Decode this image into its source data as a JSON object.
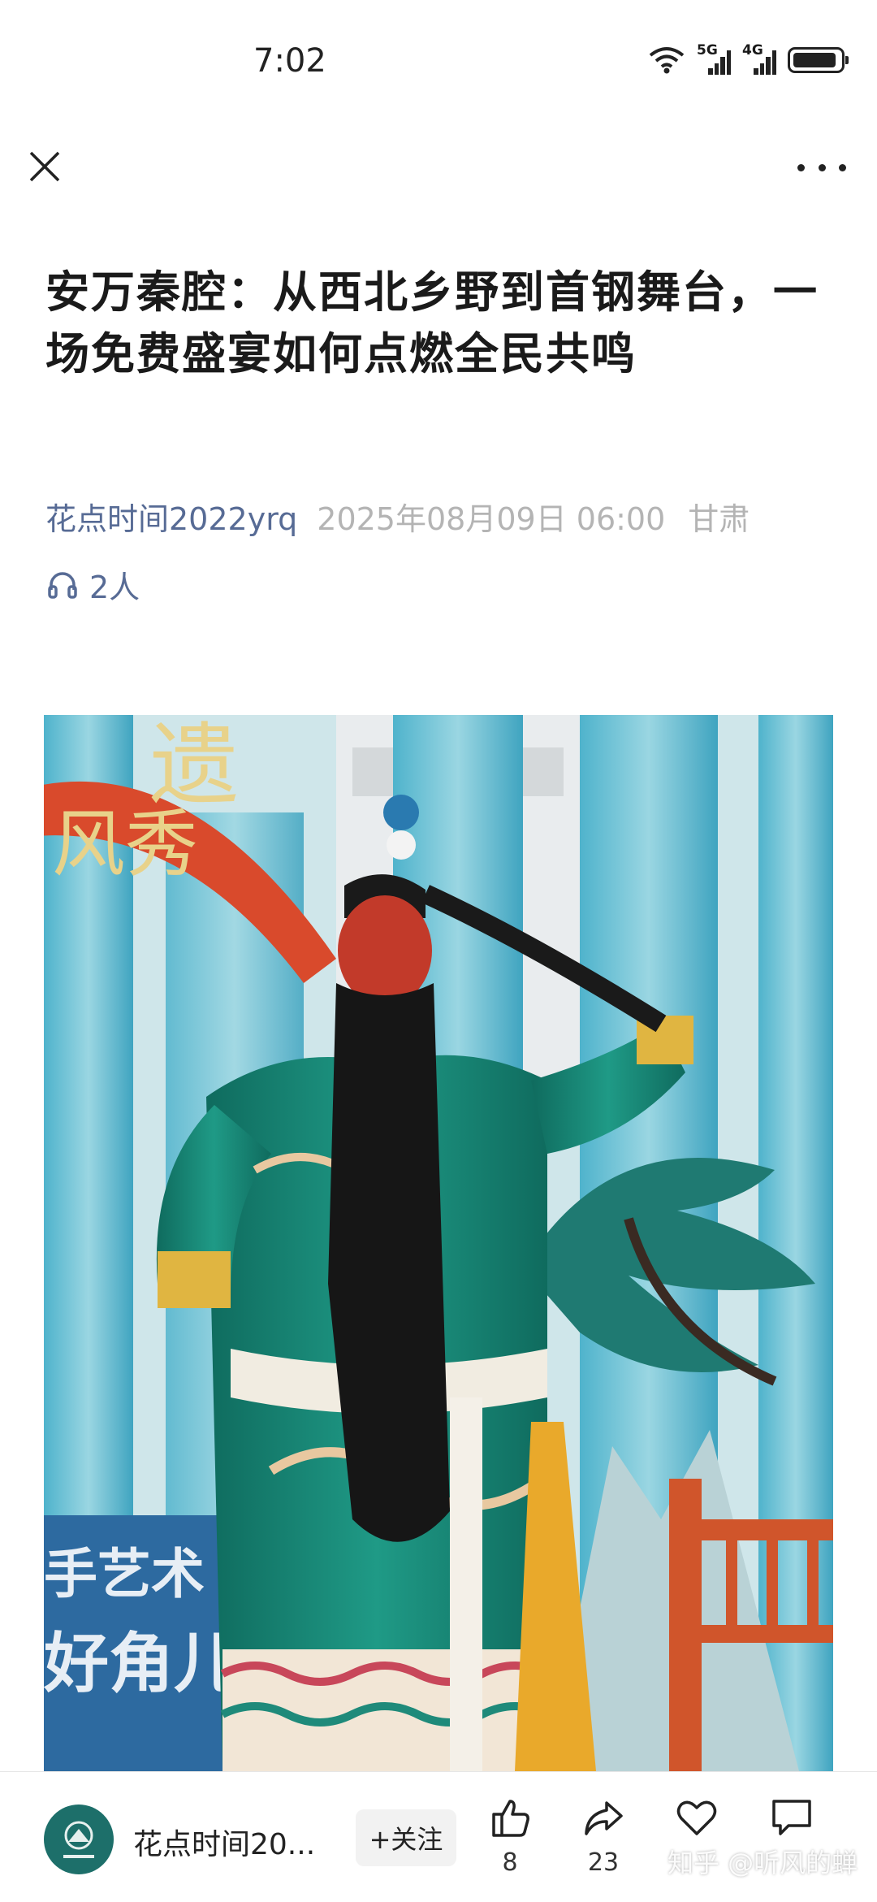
{
  "status_bar": {
    "time": "7:02",
    "net1": "5G",
    "net2": "4G"
  },
  "article": {
    "title": "安万秦腔：从西北乡野到首钢舞台，一场免费盛宴如何点燃全民共鸣",
    "author": "花点时间2022yrq",
    "date": "2025年08月09日 06:00",
    "region": "甘肃",
    "listeners": "2人"
  },
  "photo": {
    "banner_top": "遗",
    "banner_sub": "风秀",
    "sign_line1": "手艺术",
    "sign_line2": "好角儿"
  },
  "bottom_bar": {
    "account_name": "花点时间20...",
    "follow_label": "+关注",
    "like_count": "8",
    "share_count": "23",
    "favorite_count": "",
    "comment_count": "",
    "watermark": "知乎 @听风的蝉"
  },
  "colors": {
    "accent_link": "#576b95",
    "meta_gray": "#b4b4b4"
  }
}
